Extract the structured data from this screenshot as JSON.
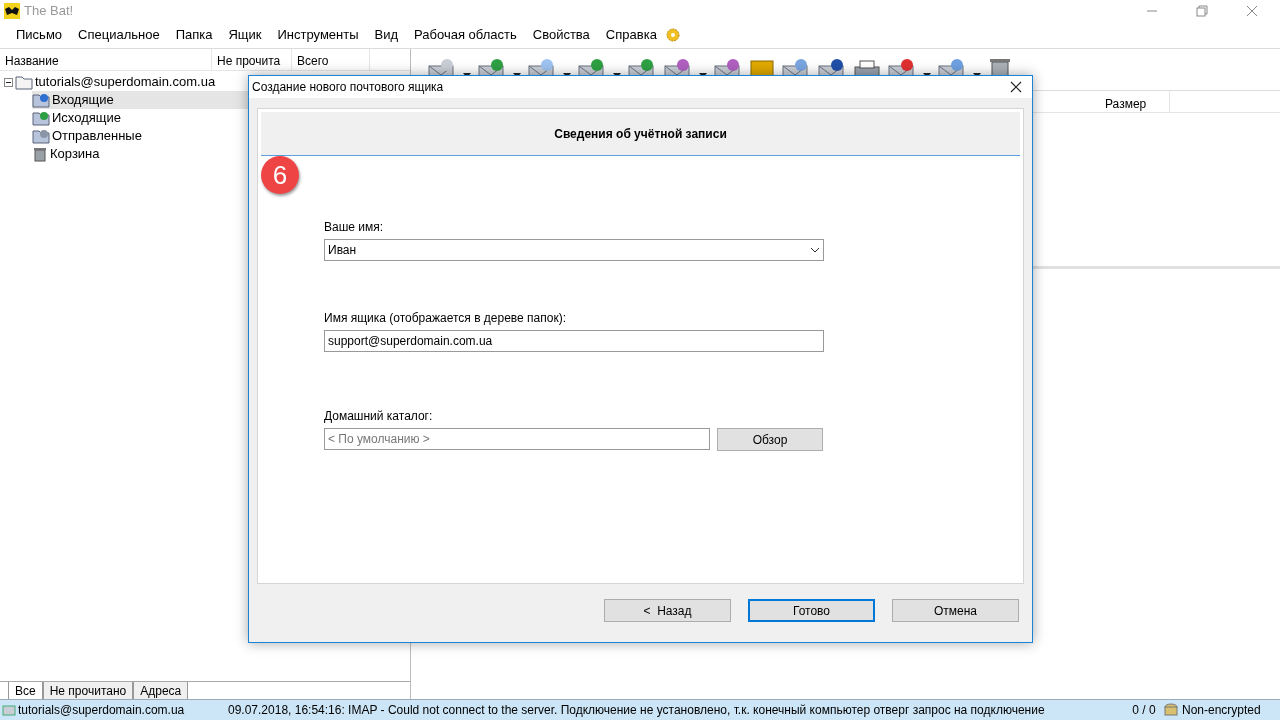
{
  "window": {
    "title": "The Bat!"
  },
  "menu": [
    "Письмо",
    "Специальное",
    "Папка",
    "Ящик",
    "Инструменты",
    "Вид",
    "Рабочая область",
    "Свойства",
    "Справка"
  ],
  "folder_columns": [
    "Название",
    "Не прочита",
    "Всего"
  ],
  "tree": [
    {
      "label": "tutorials@superdomain.com.ua",
      "kind": "account",
      "expanded": true,
      "selected": false,
      "children": [
        {
          "label": "Входящие",
          "kind": "inbox",
          "selected": true
        },
        {
          "label": "Исходящие",
          "kind": "outbox",
          "selected": false
        },
        {
          "label": "Отправленные",
          "kind": "sent",
          "selected": false
        },
        {
          "label": "Корзина",
          "kind": "trash",
          "selected": false
        }
      ]
    }
  ],
  "message_columns": [
    "Размер"
  ],
  "bottom_tabs": [
    {
      "label": "Все",
      "selected": true
    },
    {
      "label": "Не прочитано",
      "selected": false
    },
    {
      "label": "Адреса",
      "selected": false
    }
  ],
  "status_bar": {
    "account": "tutorials@superdomain.com.ua",
    "message": "09.07.2018, 16:54:16: IMAP  - Could not connect to the server. Подключение не установлено, т.к. конечный компьютер отверг запрос на подключение",
    "count": "0 / 0",
    "security": "Non-encrypted"
  },
  "dialog": {
    "title": "Создание нового почтового ящика",
    "header": "Сведения об учётной записи",
    "step": "6",
    "fields": [
      {
        "kind": "combo",
        "label": "Ваше имя:",
        "value": "Иван"
      },
      {
        "kind": "text",
        "label": "Имя ящика (отображается в дереве папок):",
        "value": "support@superdomain.com.ua"
      },
      {
        "kind": "browse",
        "label": "Домашний каталог:",
        "placeholder": "< По умолчанию >",
        "button": "Обзор"
      }
    ],
    "buttons": [
      {
        "label": "<  Назад",
        "default": false
      },
      {
        "label": "Готово",
        "default": true
      },
      {
        "label": "Отмена",
        "default": false
      }
    ]
  }
}
